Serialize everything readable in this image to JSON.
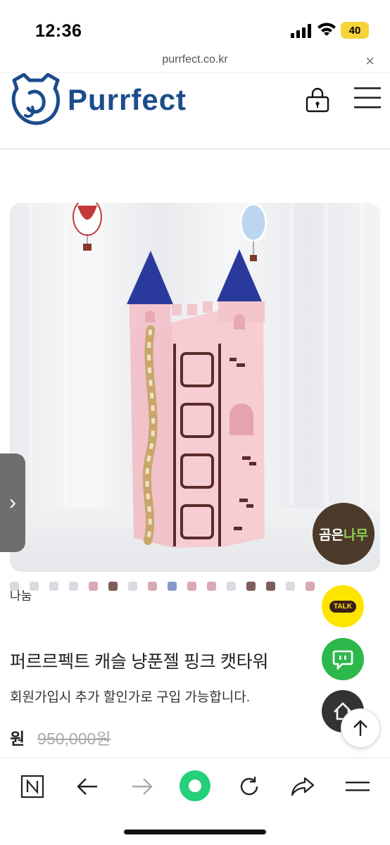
{
  "status": {
    "time": "12:36",
    "battery": "40"
  },
  "browser": {
    "url": "purrfect.co.kr",
    "close": "×"
  },
  "header": {
    "logo": "Purrfect"
  },
  "product": {
    "brand_badge_main": "곰은",
    "brand_badge_accent": "나무",
    "thumb_label": "나눔",
    "title": "퍼르르펙트 캐슬 냥푼젤 핑크 캣타워",
    "description": "회원가입시 추가 할인가로 구입 가능합니다.",
    "price_unit": "원",
    "original_price": "950,000원"
  },
  "fabs": {
    "talk": "TALK"
  },
  "colors": {
    "brand": "#1c4c8c",
    "kakao": "#fde500",
    "chat": "#2db84b"
  }
}
